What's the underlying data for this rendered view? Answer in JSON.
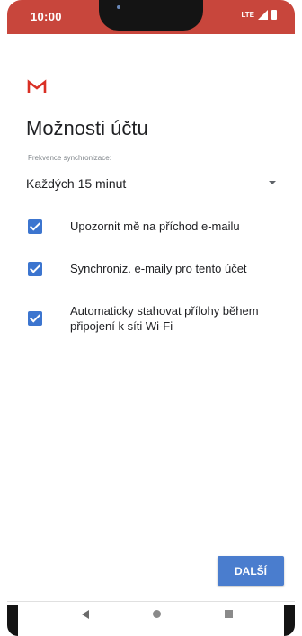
{
  "status_bar": {
    "time": "10:00",
    "network": "LTE",
    "color": "#c8463c",
    "icons": [
      "signal-icon",
      "battery-icon"
    ]
  },
  "header": {
    "logo_icon": "gmail-logo-icon",
    "title": "Možnosti účtu"
  },
  "sync": {
    "label": "Frekvence synchronizace:",
    "value": "Každých 15 minut"
  },
  "options": [
    {
      "label": "Upozornit mě na příchod e-mailu",
      "checked": true
    },
    {
      "label": "Synchroniz. e-maily pro tento účet",
      "checked": true
    },
    {
      "label": "Automaticky stahovat přílohy během připojení k síti Wi-Fi",
      "checked": true
    }
  ],
  "actions": {
    "next_label": "DALŠÍ",
    "next_color": "#4a7dce"
  },
  "nav_bar": {
    "icons": [
      "back-icon",
      "home-icon",
      "recents-icon"
    ]
  }
}
